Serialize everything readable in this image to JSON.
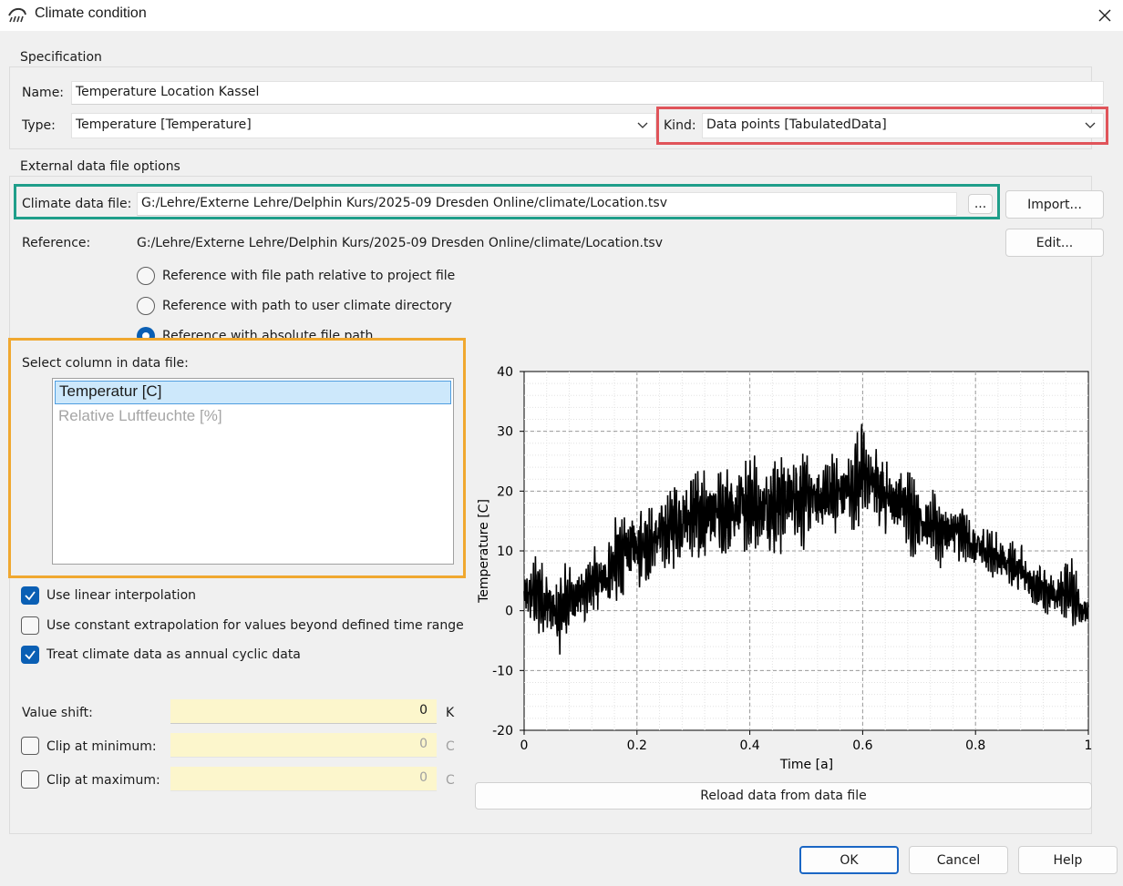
{
  "window": {
    "title": "Climate condition",
    "icon": "rain-cloud-icon",
    "close_icon": "close-icon"
  },
  "specification": {
    "group_title": "Specification",
    "name_label": "Name:",
    "name_value": "Temperature Location Kassel",
    "type_label": "Type:",
    "type_value": "Temperature [Temperature]",
    "kind_label": "Kind:",
    "kind_value": "Data points [TabulatedData]"
  },
  "external": {
    "group_title": "External data file options",
    "file_label": "Climate data file:",
    "file_value": "G:/Lehre/Externe Lehre/Delphin Kurs/2025-09 Dresden Online/climate/Location.tsv",
    "browse_label": "...",
    "import_label": "Import...",
    "reference_label": "Reference:",
    "reference_value": "G:/Lehre/Externe Lehre/Delphin Kurs/2025-09 Dresden Online/climate/Location.tsv",
    "edit_label": "Edit...",
    "radio_options": [
      {
        "label": "Reference with file path relative to project file",
        "checked": false
      },
      {
        "label": "Reference with path to user climate directory",
        "checked": false
      },
      {
        "label": "Reference with absolute file path",
        "checked": true
      }
    ]
  },
  "column_select": {
    "label": "Select column in data file:",
    "items": [
      {
        "label": "Temperatur [C]",
        "selected": true,
        "enabled": true
      },
      {
        "label": "Relative Luftfeuchte [%]",
        "selected": false,
        "enabled": false
      }
    ]
  },
  "options": {
    "linear_interpolation": {
      "label": "Use linear interpolation",
      "checked": true
    },
    "constant_extrapolation": {
      "label": "Use constant extrapolation for values beyond defined time range",
      "checked": false
    },
    "annual_cyclic": {
      "label": "Treat climate data as annual cyclic data",
      "checked": true
    }
  },
  "value_shift": {
    "label": "Value shift:",
    "value": "0",
    "unit": "K"
  },
  "clip_min": {
    "label": "Clip at minimum:",
    "value": "0",
    "unit": "C",
    "checked": false
  },
  "clip_max": {
    "label": "Clip at maximum:",
    "value": "0",
    "unit": "C",
    "checked": false
  },
  "reload_label": "Reload data from data file",
  "buttons": {
    "ok": "OK",
    "cancel": "Cancel",
    "help": "Help"
  },
  "annotation_colors": {
    "kind_box": "#e0545a",
    "file_box": "#1f9e8a",
    "column_box": "#f0a830",
    "accent": "#0a5fb4"
  },
  "chart_data": {
    "type": "line",
    "xlabel": "Time [a]",
    "ylabel": "Temperature [C]",
    "xlim": [
      0,
      1
    ],
    "ylim": [
      -20,
      40
    ],
    "x_ticks": [
      "0",
      "0.2",
      "0.4",
      "0.6",
      "0.8",
      "1"
    ],
    "y_ticks": [
      "-20",
      "-10",
      "0",
      "10",
      "20",
      "30",
      "40"
    ],
    "grid": true,
    "series": [
      {
        "color": "#000000",
        "x": [
          0.0,
          0.02,
          0.04,
          0.06,
          0.08,
          0.1,
          0.12,
          0.14,
          0.16,
          0.18,
          0.2,
          0.22,
          0.24,
          0.26,
          0.28,
          0.3,
          0.32,
          0.34,
          0.36,
          0.38,
          0.4,
          0.42,
          0.44,
          0.46,
          0.48,
          0.5,
          0.52,
          0.54,
          0.56,
          0.58,
          0.6,
          0.62,
          0.64,
          0.66,
          0.68,
          0.7,
          0.72,
          0.74,
          0.76,
          0.78,
          0.8,
          0.82,
          0.84,
          0.86,
          0.88,
          0.9,
          0.92,
          0.94,
          0.96,
          0.98,
          1.0
        ],
        "y_min": [
          -3,
          -4,
          -6,
          -9,
          -5,
          -4,
          -2,
          -2,
          0,
          1,
          2,
          3,
          5,
          6,
          6,
          7,
          5,
          8,
          7,
          7,
          9,
          8,
          8,
          8,
          10,
          10,
          10,
          11,
          12,
          12,
          13,
          12,
          11,
          10,
          9,
          8,
          7,
          6,
          8,
          7,
          5,
          5,
          4,
          3,
          2,
          -1,
          0,
          -3,
          -2,
          -4,
          -5
        ],
        "y_max": [
          8,
          10,
          9,
          6,
          10,
          9,
          11,
          12,
          16,
          18,
          21,
          19,
          20,
          22,
          24,
          25,
          26,
          24,
          25,
          27,
          28,
          26,
          28,
          30,
          28,
          28,
          27,
          28,
          27,
          29,
          33,
          31,
          28,
          27,
          25,
          23,
          21,
          20,
          19,
          18,
          16,
          15,
          14,
          13,
          12,
          9,
          8,
          7,
          10,
          8,
          3
        ]
      }
    ]
  }
}
